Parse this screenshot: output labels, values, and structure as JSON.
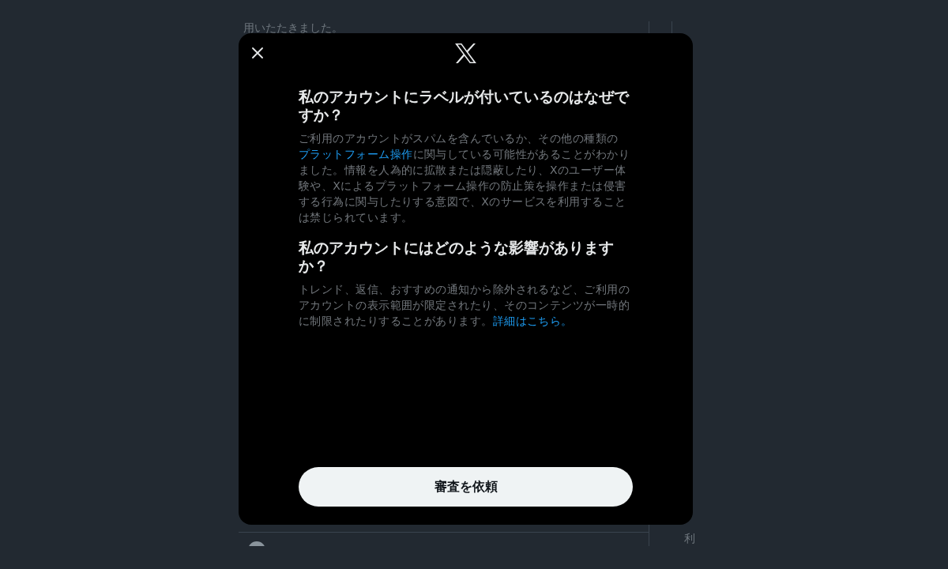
{
  "background_page": {
    "post_text": "用いたたきました。",
    "sidebar_text": "利"
  },
  "dialog": {
    "sections": [
      {
        "heading": "私のアカウントにラベルが付いているのはなぜですか？",
        "body": [
          {
            "kind": "text",
            "text": "ご利用のアカウントがスパムを含んでいるか、その他の種類の"
          },
          {
            "kind": "link",
            "text": "プラットフォーム操作"
          },
          {
            "kind": "text",
            "text": "に関与している可能性があることがわかりました。情報を人為的に拡散または隠蔽したり、Xのユーザー体験や、Xによるプラットフォーム操作の防止策を操作または侵害する行為に関与したりする意図で、Xのサービスを利用することは禁じられています。"
          }
        ]
      },
      {
        "heading": "私のアカウントにはどのような影響がありますか？",
        "body": [
          {
            "kind": "text",
            "text": "トレンド、返信、おすすめの通知から除外されるなど、ご利用のアカウントの表示範囲が限定されたり、そのコンテンツが一時的に制限されたりすることがあります。"
          },
          {
            "kind": "link",
            "text": "詳細はこちら。"
          }
        ]
      }
    ],
    "button": "審査を依頼"
  }
}
